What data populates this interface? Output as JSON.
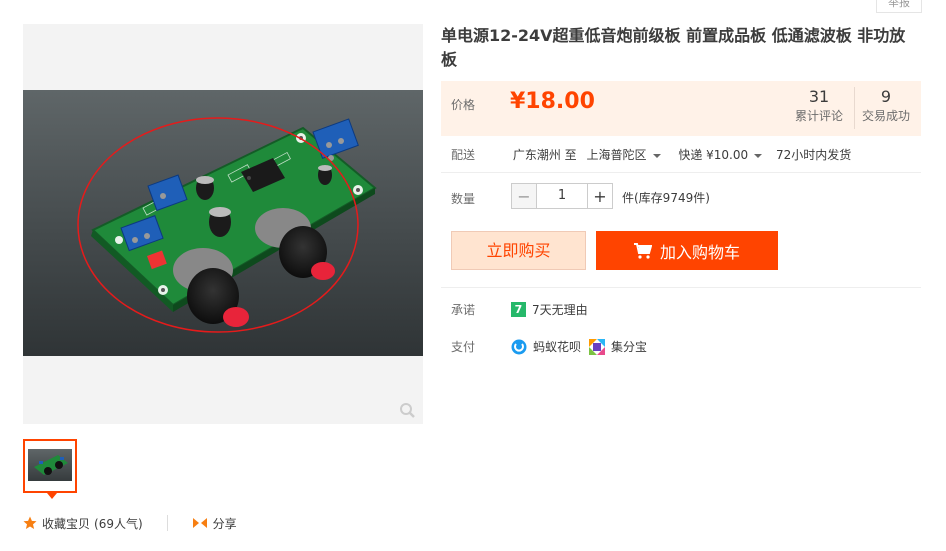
{
  "header": {
    "report_label": "举报"
  },
  "product": {
    "title": "单电源12-24V超重低音炮前级板 前置成品板 低通滤波板 非功放板"
  },
  "price": {
    "label": "价格",
    "value": "¥18.00",
    "reviews_count": "31",
    "reviews_label": "累计评论",
    "sales_count": "9",
    "sales_label": "交易成功"
  },
  "shipping": {
    "label": "配送",
    "from": "广东潮州 至",
    "to": "上海普陀区",
    "method": "快递 ¥10.00",
    "dispatch": "72小时内发货"
  },
  "quantity": {
    "label": "数量",
    "value": "1",
    "stock": "件(库存9749件)",
    "minus": "−",
    "plus": "+"
  },
  "actions": {
    "buy_now": "立即购买",
    "add_to_cart": "加入购物车"
  },
  "promise": {
    "label": "承诺",
    "badge": "7",
    "text": "7天无理由"
  },
  "payment": {
    "label": "支付",
    "method1": "蚂蚁花呗",
    "method2": "集分宝"
  },
  "social": {
    "favorite": "收藏宝贝",
    "favorite_count": "(69人气)",
    "share": "分享"
  },
  "colors": {
    "accent": "#ff4400",
    "price_bg": "#fff2e8"
  }
}
